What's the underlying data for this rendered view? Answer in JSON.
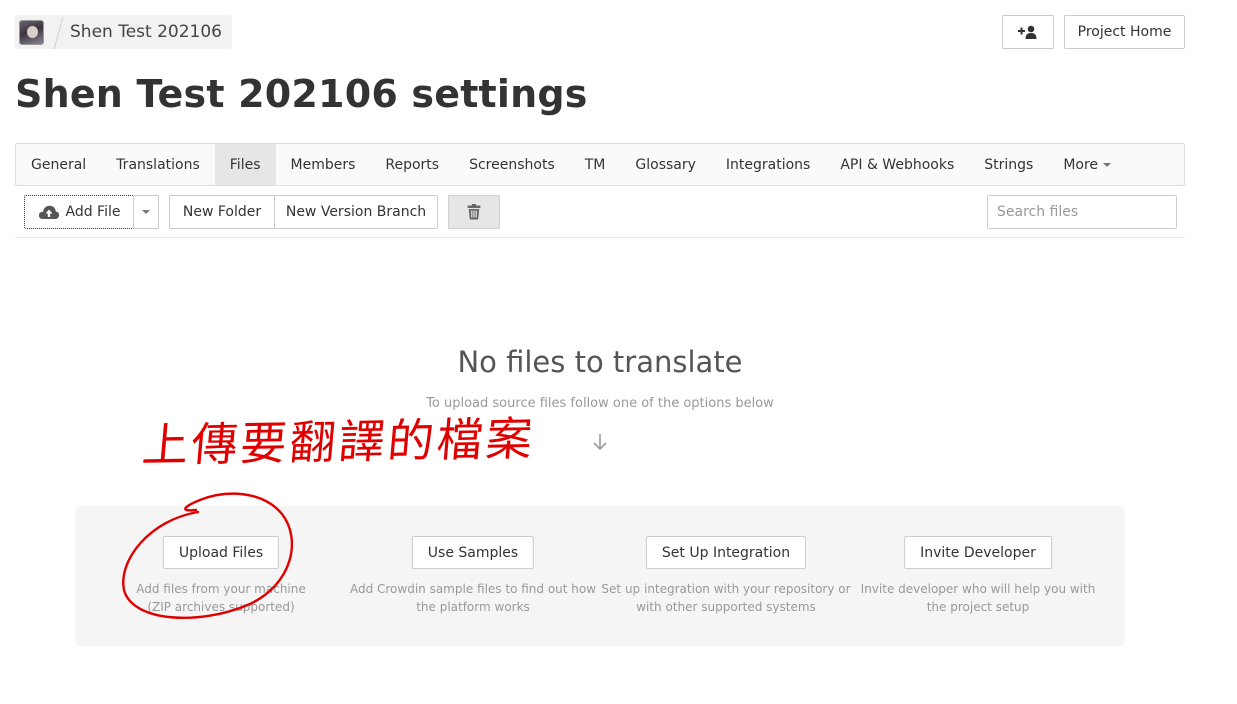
{
  "header": {
    "project_name": "Shen Test 202106",
    "invite_icon": "add-user-icon",
    "project_home_label": "Project Home"
  },
  "page_title": "Shen Test 202106 settings",
  "tabs": [
    {
      "label": "General"
    },
    {
      "label": "Translations"
    },
    {
      "label": "Files",
      "active": true
    },
    {
      "label": "Members"
    },
    {
      "label": "Reports"
    },
    {
      "label": "Screenshots"
    },
    {
      "label": "TM"
    },
    {
      "label": "Glossary"
    },
    {
      "label": "Integrations"
    },
    {
      "label": "API & Webhooks"
    },
    {
      "label": "Strings"
    },
    {
      "label": "More"
    }
  ],
  "toolbar": {
    "add_file_label": "Add File",
    "new_folder_label": "New Folder",
    "new_version_branch_label": "New Version Branch",
    "search_placeholder": "Search files"
  },
  "empty_state": {
    "title": "No files to translate",
    "subtitle": "To upload source files follow one of the options below"
  },
  "options": [
    {
      "button": "Upload Files",
      "description_line1": "Add files from your machine",
      "description_line2": "(ZIP archives supported)"
    },
    {
      "button": "Use Samples",
      "description_line1": "Add Crowdin sample files to find out how",
      "description_line2": "the platform works"
    },
    {
      "button": "Set Up Integration",
      "description_line1": "Set up integration with your repository or",
      "description_line2": "with other supported systems"
    },
    {
      "button": "Invite Developer",
      "description_line1": "Invite developer who will help you with",
      "description_line2": "the project setup"
    }
  ],
  "annotation": {
    "text": "上傳要翻譯的檔案",
    "color": "#e00000"
  },
  "colors": {
    "active_tab": "#e6e6e6",
    "annotation_red": "#e00000"
  }
}
